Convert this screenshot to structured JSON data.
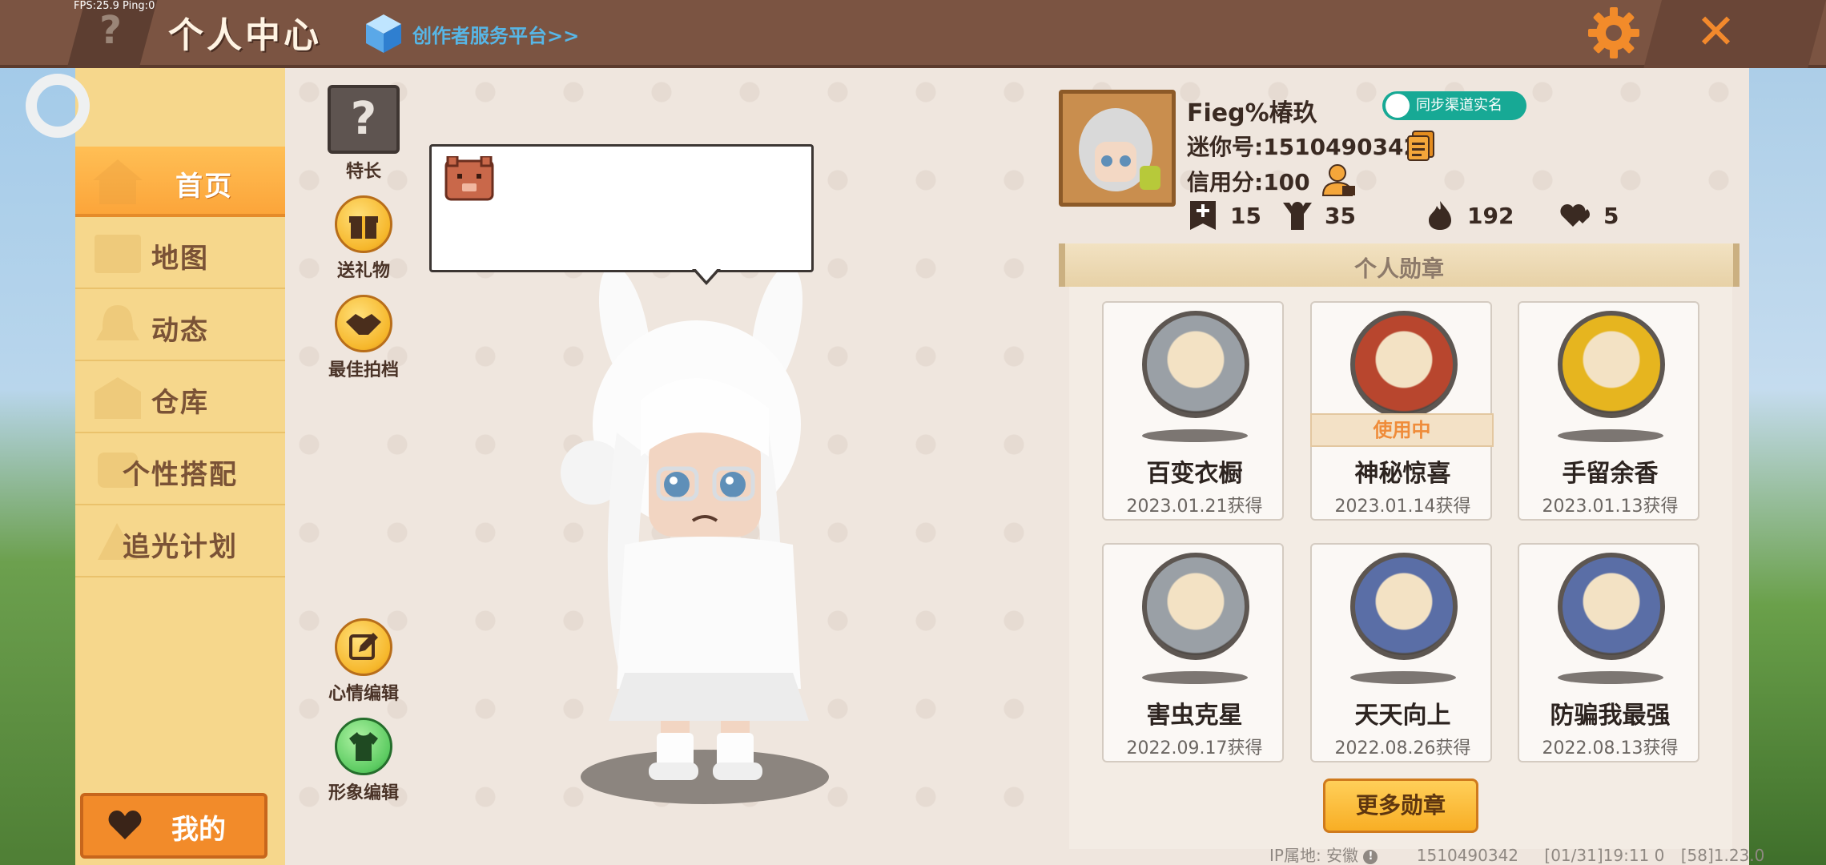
{
  "header": {
    "fps_text": "FPS:25.9  Ping:0",
    "help_label": "?",
    "title": "个人中心",
    "creator_link": "创作者服务平台>>",
    "close_label": "✕"
  },
  "sidebar": {
    "items": [
      {
        "label": "首页",
        "active": true
      },
      {
        "label": "地图"
      },
      {
        "label": "动态"
      },
      {
        "label": "仓库"
      },
      {
        "label": "个性搭配"
      },
      {
        "label": "追光计划"
      }
    ],
    "mine_label": "我的"
  },
  "actions": {
    "talent": "特长",
    "talent_icon_text": "?",
    "gift": "送礼物",
    "best_shot": "最佳拍档",
    "mood_edit": "心情编辑",
    "avatar_edit": "形象编辑"
  },
  "profile": {
    "nickname": "Fieg%椿玖",
    "sync_button": "同步渠道实名",
    "mini_id": "迷你号:1510490342",
    "credit": "信用分:100",
    "stats": {
      "friends": "15",
      "fans": "35",
      "heat": "192",
      "likes": "5"
    }
  },
  "medals": {
    "header": "个人勋章",
    "items": [
      {
        "name": "百变衣橱",
        "date": "2023.01.21获得",
        "coin_color": "#9aa0a6",
        "in_use": false
      },
      {
        "name": "神秘惊喜",
        "date": "2023.01.14获得",
        "coin_color": "#b8462e",
        "in_use": true,
        "in_use_label": "使用中"
      },
      {
        "name": "手留余香",
        "date": "2023.01.13获得",
        "coin_color": "#e6b51f",
        "in_use": false
      },
      {
        "name": "害虫克星",
        "date": "2022.09.17获得",
        "coin_color": "#9aa0a6",
        "in_use": false
      },
      {
        "name": "天天向上",
        "date": "2022.08.26获得",
        "coin_color": "#5a6ea6",
        "in_use": false
      },
      {
        "name": "防骗我最强",
        "date": "2022.08.13获得",
        "coin_color": "#5a6ea6",
        "in_use": false
      }
    ],
    "more_button": "更多勋章"
  },
  "footer": {
    "ip": "IP属地: 安徽",
    "info_glyph": "!",
    "uid": "1510490342",
    "time": "[01/31]19:11 0",
    "version": "[58]1.23.0"
  },
  "colors": {
    "accent_orange": "#f28b2a",
    "topbar_brown": "#7b5442",
    "sidebar_yellow": "#f6d78c",
    "sync_teal": "#17a995"
  }
}
